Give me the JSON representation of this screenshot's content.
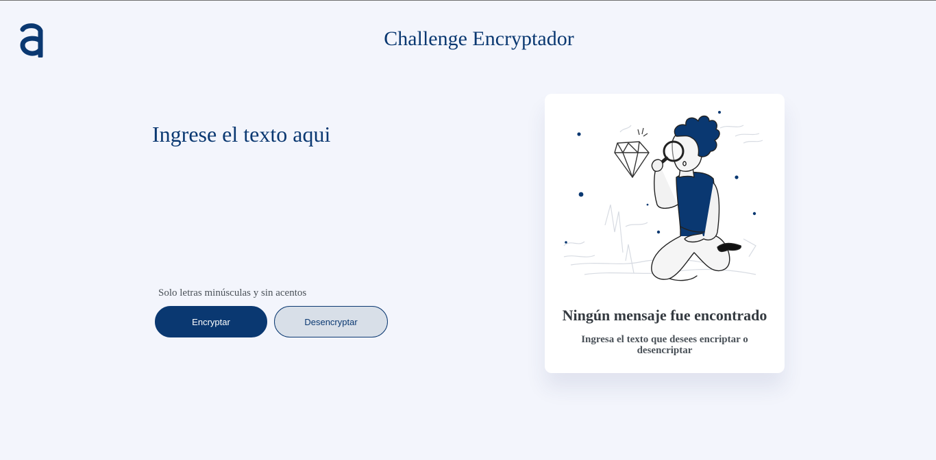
{
  "header": {
    "logo_icon": "alura-a-logo-icon",
    "title": "Challenge Encryptador"
  },
  "editor": {
    "placeholder": "Ingrese el texto aqui",
    "value": ""
  },
  "hint": {
    "icon": "info-icon",
    "text": "Solo letras minúsculas y sin acentos"
  },
  "buttons": {
    "encrypt_label": "Encryptar",
    "decrypt_label": "Desencryptar"
  },
  "result_panel": {
    "illustration": "person-with-magnifying-glass-illustration",
    "title": "Ningún mensaje fue encontrado",
    "subtitle": "Ingresa el texto que desees encriptar o desencriptar"
  },
  "colors": {
    "primary": "#0a3871",
    "background": "#f3f5fc",
    "card": "#ffffff",
    "secondary_button": "#d8dfe8",
    "text_dark": "#343a40",
    "text_muted": "#495057"
  }
}
